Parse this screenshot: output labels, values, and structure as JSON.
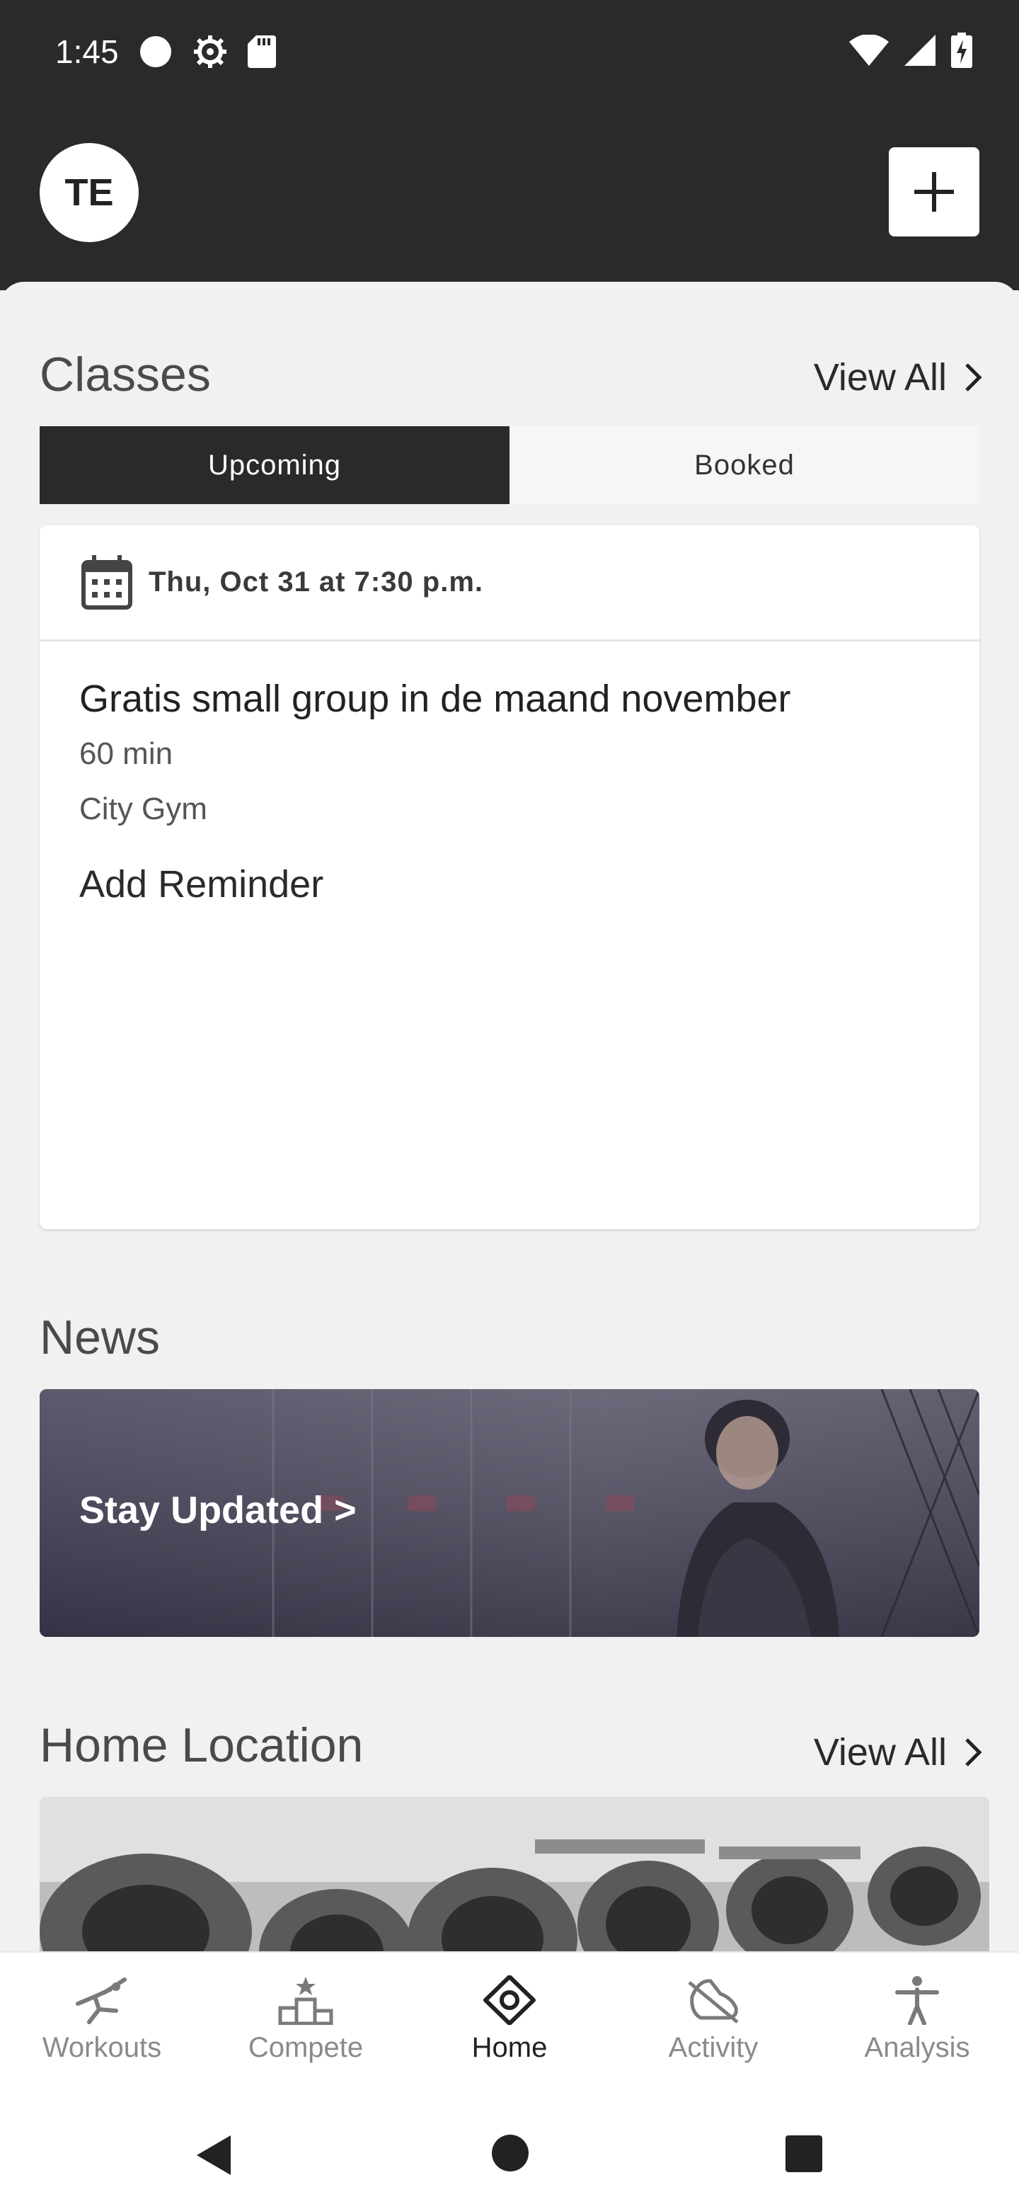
{
  "status_bar": {
    "time": "1:45",
    "left_icons": [
      "circle-icon",
      "settings-icon",
      "sd-card-icon"
    ],
    "right_icons": [
      "wifi-icon",
      "signal-icon",
      "battery-charging-icon"
    ]
  },
  "header": {
    "avatar_initials": "TE",
    "add_icon": "plus-icon"
  },
  "classes": {
    "title": "Classes",
    "view_all": "View All",
    "tabs": [
      {
        "label": "Upcoming",
        "selected": true
      },
      {
        "label": "Booked",
        "selected": false
      }
    ],
    "card": {
      "date": "Thu, Oct 31 at 7:30 p.m.",
      "class_name": "Gratis small group in de maand november",
      "duration": "60 min",
      "location": "City Gym",
      "add_reminder": "Add Reminder"
    }
  },
  "news": {
    "title": "News",
    "banner_label": "Stay Updated >"
  },
  "home_location": {
    "title": "Home Location",
    "view_all": "View All"
  },
  "bottom_nav": {
    "items": [
      {
        "label": "Workouts",
        "icon": "running-figure-icon",
        "active": false
      },
      {
        "label": "Compete",
        "icon": "podium-icon",
        "active": false
      },
      {
        "label": "Home",
        "icon": "home-diamond-icon",
        "active": true
      },
      {
        "label": "Activity",
        "icon": "shoe-icon",
        "active": false
      },
      {
        "label": "Analysis",
        "icon": "person-figure-icon",
        "active": false
      }
    ]
  },
  "colors": {
    "header_bg": "#2a2a2b",
    "page_bg": "#f1f1f1",
    "active_tab": "#2a2a2b",
    "nav_inactive": "#8a8a8a"
  }
}
